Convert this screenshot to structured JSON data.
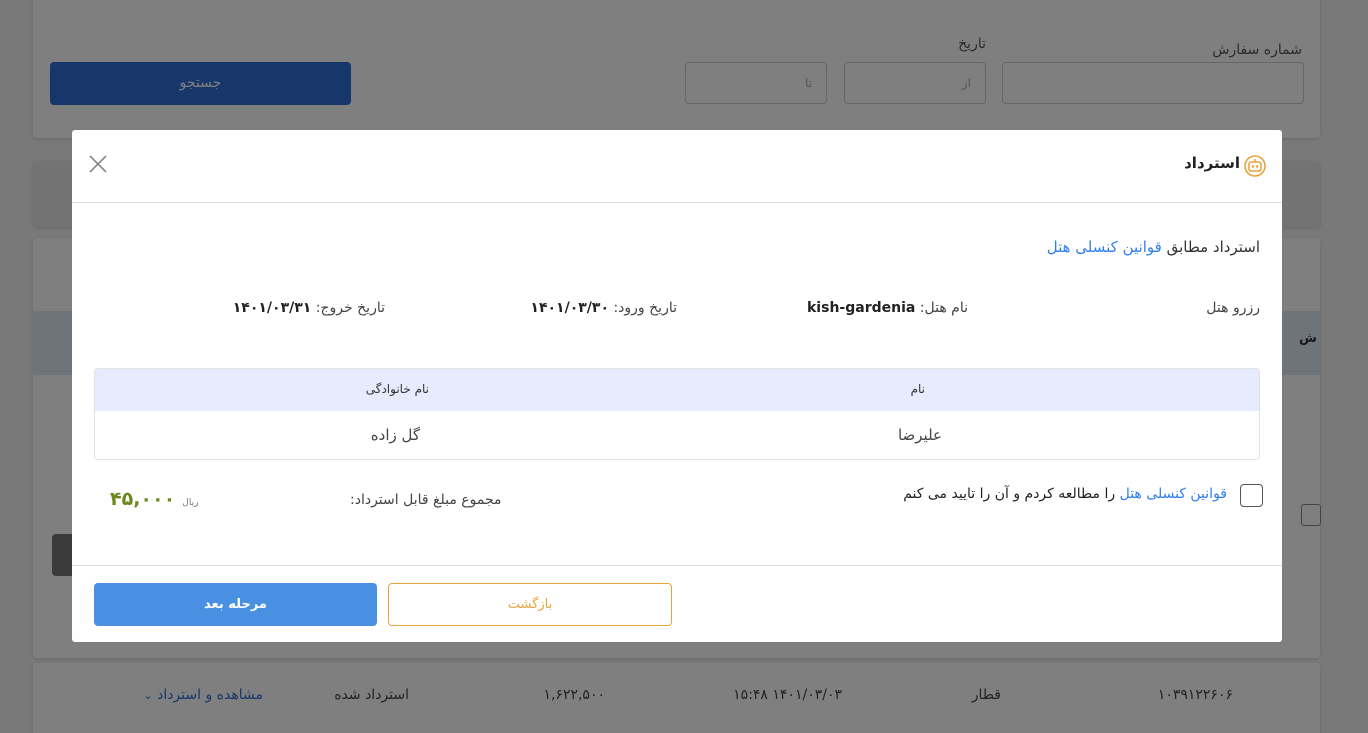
{
  "search": {
    "order_number_label": "شماره سفارش",
    "date_label": "تاریخ",
    "from_placeholder": "از",
    "to_placeholder": "تا",
    "search_button": "جستجو"
  },
  "list": {
    "header_fragment": "ش"
  },
  "row": {
    "id": "۱۰۳۹۱۲۲۶۰۶",
    "type": "قطار",
    "datetime": "۱۴۰۱/۰۳/۰۳ ۱۵:۴۸",
    "amount": "۱,۶۲۲,۵۰۰",
    "status": "استرداد شده",
    "action": "مشاهده و استرداد"
  },
  "modal": {
    "title": "استرداد",
    "title_icon": "robot-icon",
    "policy_prefix": "استرداد مطابق",
    "policy_link": "قوانین کنسلی هتل",
    "reservation_type": "رزرو هتل",
    "hotel_name_label": "نام هتل:",
    "hotel_name": "kish-gardenia",
    "checkin_label": "تاریخ ورود:",
    "checkin": "۱۴۰۱/۰۳/۳۰",
    "checkout_label": "تاریخ خروج:",
    "checkout": "۱۴۰۱/۰۳/۳۱",
    "table": {
      "headers": [
        "نام",
        "نام خانوادگی"
      ],
      "rows": [
        [
          "علیرضا",
          "گل زاده"
        ]
      ]
    },
    "agree_link": "قوانین کنسلی هتل",
    "agree_text": "را مطالعه کردم و آن را تایید می کنم",
    "total_label": "مجموع مبلغ قابل استرداد:",
    "total_amount": "۴۵,۰۰۰",
    "currency": "ریال",
    "next_button": "مرحله بعد",
    "back_button": "بازگشت"
  },
  "colors": {
    "primary": "#4a90e2",
    "accent": "#e8a33c",
    "amount": "#6a8a1e",
    "link": "#2f80ed"
  }
}
